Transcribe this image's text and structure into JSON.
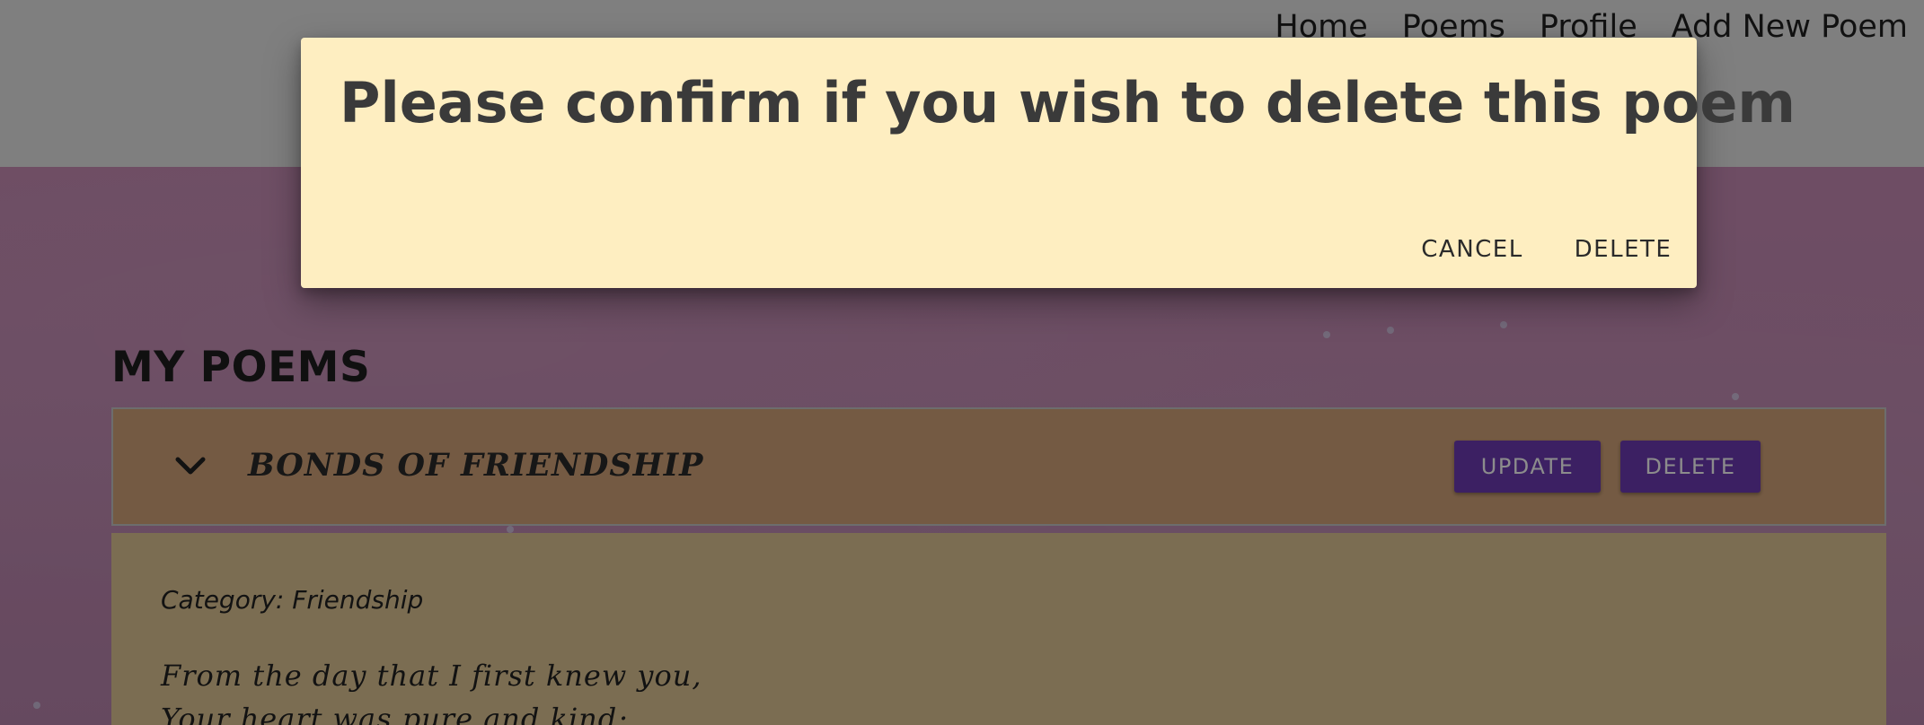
{
  "nav": {
    "items": [
      "Home",
      "Poems",
      "Profile",
      "Add New Poem"
    ]
  },
  "page": {
    "section_title": "MY POEMS"
  },
  "poem": {
    "title": "BONDS OF FRIENDSHIP",
    "update_label": "UPDATE",
    "delete_label": "DELETE",
    "category": "Category: Friendship",
    "lines": [
      "From the day that I first knew you,",
      "Your heart was pure and kind;"
    ]
  },
  "modal": {
    "title": "Please confirm if you wish to delete this poem",
    "cancel_label": "CANCEL",
    "delete_label": "DELETE"
  },
  "colors": {
    "navbar": "#e8e8e8",
    "hero": "#c98db6",
    "poem_header": "#d4a57b",
    "poem_body": "#e1c796",
    "button": "#6d3bb4",
    "modal": "#feeec1"
  },
  "icons": {
    "chevron": "chevron-down-icon"
  }
}
